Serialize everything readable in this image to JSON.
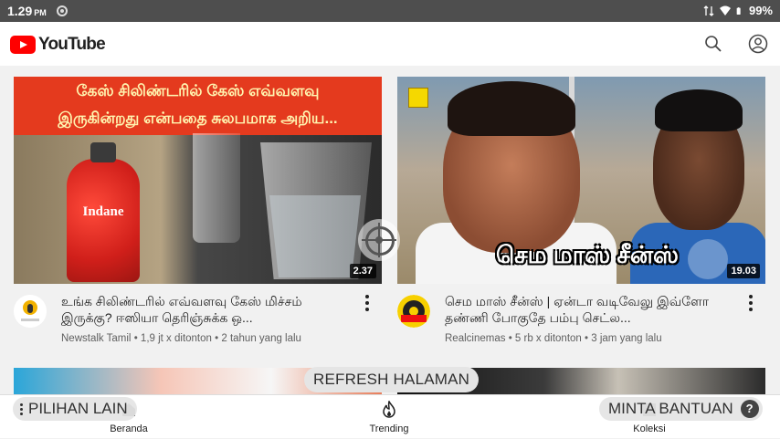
{
  "status_bar": {
    "time": "1.29",
    "ampm": "PM",
    "battery": "99%"
  },
  "app": {
    "logo_text": "YouTube"
  },
  "videos": [
    {
      "thumb_line1": "கேஸ் சிலிண்டரில் கேஸ் எவ்வளவு",
      "thumb_line2": "இருகின்றது என்பதை சுலபமாக அறிய...",
      "thumb_brand": "Indane",
      "duration": "2.37",
      "title": "உங்க சிலிண்டரில் எவ்வளவு கேஸ் மிச்சம் இருக்கு? ஈஸியா தெரிஞ்சுக்க ஒ...",
      "channel": "Newstalk Tamil",
      "views": "1,9 jt x ditonton",
      "age": "2 tahun yang lalu"
    },
    {
      "thumb_caption": "செம மாஸ் சீன்ஸ்",
      "duration": "19.03",
      "title": "செம மாஸ் சீன்ஸ் | ஏன்டா வடிவேலு இவ்ளோ தண்ணி போகுதே பம்பு செட்ல...",
      "channel": "Realcinemas",
      "views": "5 rb x ditonton",
      "age": "3 jam yang lalu"
    }
  ],
  "overlay": {
    "refresh_label": "REFRESH HALAMAN",
    "more_options_label": "PILIHAN LAIN",
    "help_label": "MINTA BANTUAN",
    "help_icon": "?"
  },
  "bottom_nav": {
    "home": "Beranda",
    "trending": "Trending",
    "library": "Koleksi"
  },
  "colors": {
    "brand_red": "#ff0000",
    "accent_text": "#212121",
    "subtext": "#606060"
  },
  "icons": [
    "search-icon",
    "account-icon",
    "more-vert-icon",
    "crosshair-icon",
    "home-icon",
    "trending-icon",
    "library-icon"
  ]
}
